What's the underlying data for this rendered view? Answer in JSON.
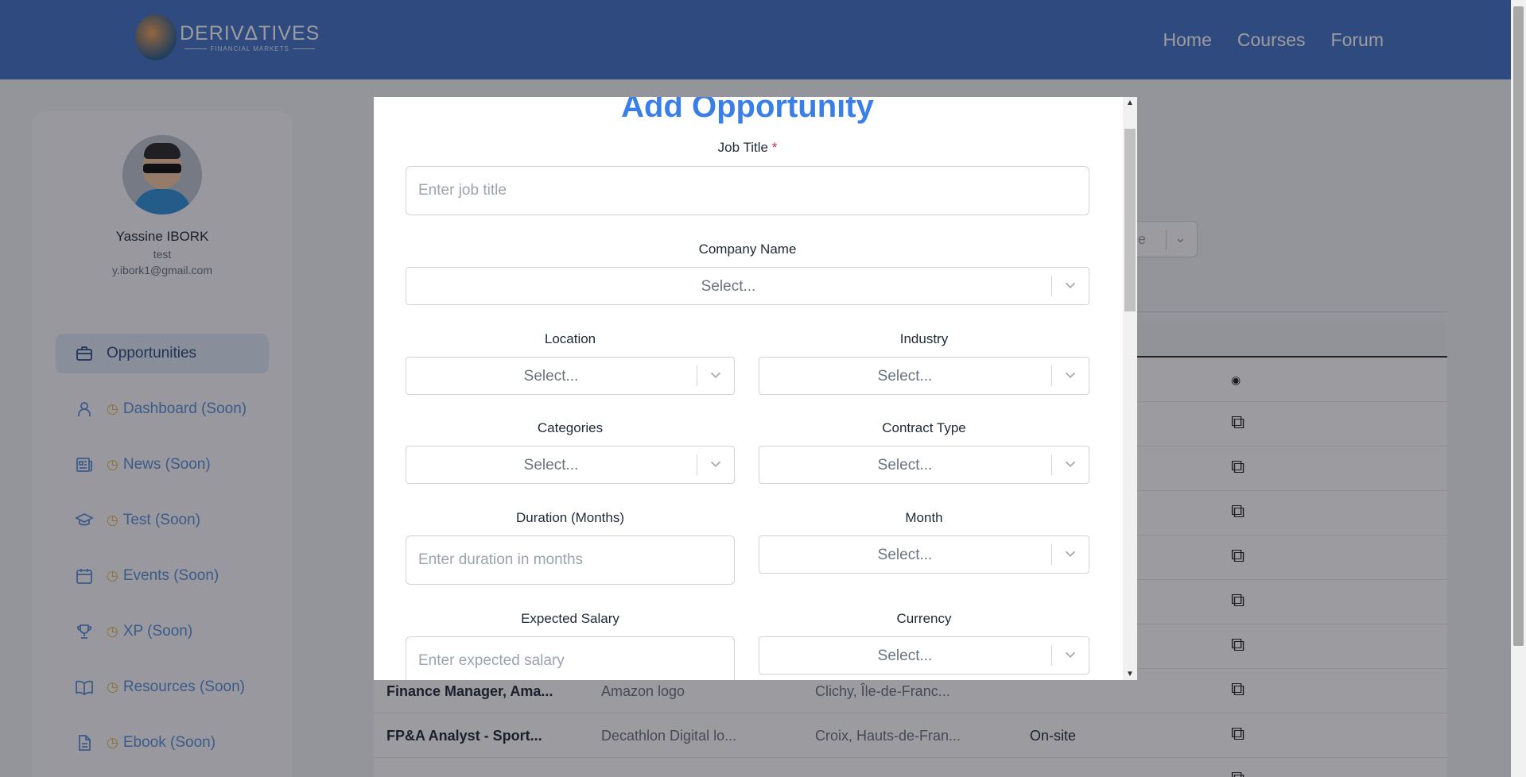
{
  "header": {
    "logo_title": "DERIVΔTIVES",
    "logo_subtitle": "FINANCIAL MARKETS",
    "nav": [
      "Home",
      "Courses",
      "Forum"
    ]
  },
  "profile": {
    "name": "Yassine IBORK",
    "role": "test",
    "email": "y.ibork1@gmail.com"
  },
  "sidebar": {
    "items": [
      {
        "label": "Opportunities",
        "icon": "briefcase-icon",
        "active": true
      },
      {
        "label": "Dashboard (Soon)",
        "icon": "user-icon"
      },
      {
        "label": "News (Soon)",
        "icon": "newspaper-icon"
      },
      {
        "label": "Test (Soon)",
        "icon": "graduation-cap-icon"
      },
      {
        "label": "Events (Soon)",
        "icon": "calendar-icon"
      },
      {
        "label": "XP (Soon)",
        "icon": "trophy-icon"
      },
      {
        "label": "Resources (Soon)",
        "icon": "book-icon"
      },
      {
        "label": "Ebook (Soon)",
        "icon": "document-icon"
      }
    ]
  },
  "background": {
    "filter_text": "pe",
    "rows": [
      {
        "title": "Finance Manager, Ama...",
        "company": "Amazon logo",
        "location": "Clichy, Île-de-Franc...",
        "type": ""
      },
      {
        "title": "FP&A Analyst - Sport...",
        "company": "Decathlon Digital lo...",
        "location": "Croix, Hauts-de-Fran...",
        "type": "On-site"
      }
    ]
  },
  "modal": {
    "title": "Add Opportunity",
    "job_title_label": "Job Title",
    "required_mark": "*",
    "job_title_placeholder": "Enter job title",
    "company_label": "Company Name",
    "location_label": "Location",
    "industry_label": "Industry",
    "categories_label": "Categories",
    "contract_label": "Contract Type",
    "duration_label": "Duration (Months)",
    "duration_placeholder": "Enter duration in months",
    "month_label": "Month",
    "salary_label": "Expected Salary",
    "salary_placeholder": "Enter expected salary",
    "currency_label": "Currency",
    "select_placeholder": "Select..."
  },
  "colors": {
    "header": "#4472c4",
    "accent": "#3a7ee8",
    "required": "#e11d48"
  }
}
